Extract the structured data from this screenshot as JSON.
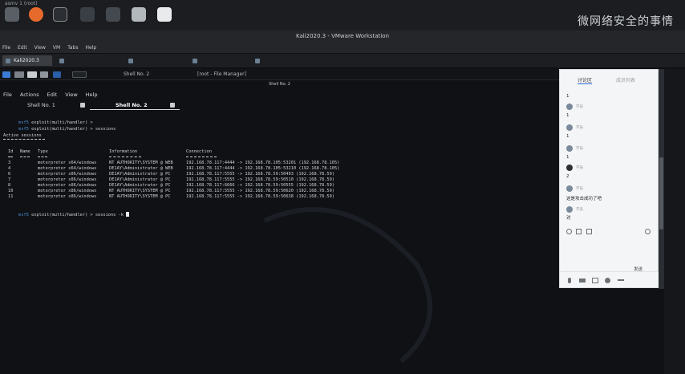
{
  "host": {
    "window_title": "asmv 1 (root)",
    "watermark": "微网络安全的事情"
  },
  "vmware": {
    "title": "Kali2020.3 - VMware Workstation",
    "menu": [
      "File",
      "Edit",
      "View",
      "VM",
      "Tabs",
      "Help"
    ],
    "tabs": [
      {
        "label": "Kali2020.3",
        "active": true
      },
      {
        "label": "",
        "active": false
      },
      {
        "label": "",
        "active": false
      },
      {
        "label": "",
        "active": false
      },
      {
        "label": "",
        "active": false
      }
    ]
  },
  "kali_panel": {
    "tasks": [
      "Shell No. 2",
      "[root - File Manager]"
    ]
  },
  "terminal": {
    "window_title": "Shell No. 2",
    "menu": [
      "File",
      "Actions",
      "Edit",
      "View",
      "Help"
    ],
    "tabs": [
      {
        "label": "Shell No. 1",
        "active": false
      },
      {
        "label": "Shell No. 2",
        "active": true
      }
    ],
    "lines": [
      {
        "prompt": "msf5",
        "text": " exploit(multi/handler) > "
      },
      {
        "prompt": "msf5",
        "text": " exploit(multi/handler) > sessions"
      }
    ],
    "section_title": "Active sessions",
    "table_headers": [
      "Id",
      "Name",
      "Type",
      "Information",
      "Connection"
    ],
    "table_rows": [
      [
        "3",
        "",
        "meterpreter x64/windows",
        "NT AUTHORITY\\SYSTEM @ WEB",
        "192.168.78.117:4444 -> 192.168.78.105:53201 (192.168.78.105)"
      ],
      [
        "4",
        "",
        "meterpreter x64/windows",
        "DE1AY\\Administrator @ WEB",
        "192.168.78.117:4444 -> 192.168.78.105:53210 (192.168.78.105)"
      ],
      [
        "6",
        "",
        "meterpreter x86/windows",
        "DE1AY\\Administrator @ PC",
        "192.168.78.117:5555 -> 192.168.78.59:50493 (192.168.78.59)"
      ],
      [
        "7",
        "",
        "meterpreter x86/windows",
        "DE1AY\\Administrator @ PC",
        "192.168.78.117:5555 -> 192.168.78.59:50510 (192.168.78.59)"
      ],
      [
        "8",
        "",
        "meterpreter x86/windows",
        "DE1AY\\Administrator @ PC",
        "192.168.78.117:6666 -> 192.168.78.59:50555 (192.168.78.59)"
      ],
      [
        "10",
        "",
        "meterpreter x86/windows",
        "NT AUTHORITY\\SYSTEM @ PC",
        "192.168.78.117:5555 -> 192.168.78.59:50620 (192.168.78.59)"
      ],
      [
        "11",
        "",
        "meterpreter x86/windows",
        "NT AUTHORITY\\SYSTEM @ PC",
        "192.168.78.117:5555 -> 192.168.78.59:50638 (192.168.78.59)"
      ]
    ],
    "last_prompt": "msf5",
    "last_text": " exploit(multi/handler) > sessions -k "
  },
  "side_panel": {
    "tab_active": "讨论区",
    "tab_other": "成员列表",
    "messages": [
      {
        "name": "",
        "text": "1"
      },
      {
        "name": "学员",
        "text": "1"
      },
      {
        "name": "学员",
        "text": "1"
      },
      {
        "name": "学员",
        "text": "1"
      },
      {
        "name": "学员",
        "text": "2"
      },
      {
        "name": "学员",
        "text": "这是攻击成功了吧"
      },
      {
        "name": "学员",
        "text": "对"
      }
    ],
    "footer_label": "发送"
  },
  "colors": {
    "prompt": "#4f8fd6",
    "terminal_bg": "#0f1115",
    "panel_bg": "#f4f5f6"
  }
}
